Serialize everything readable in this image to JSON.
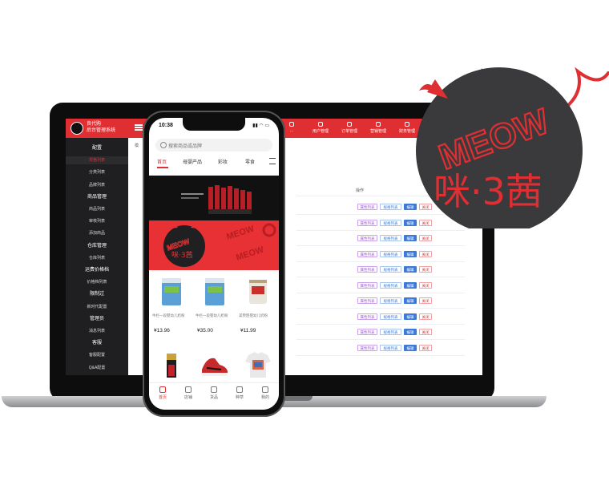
{
  "admin": {
    "brand": {
      "line1": "良代购",
      "line2": "后台管理系统"
    },
    "nav": [
      "…",
      "用户管理",
      "订单管理",
      "营销管理",
      "财务管理"
    ],
    "breadcrumb": "模",
    "sidebar": [
      {
        "label": "配置",
        "kind": "group"
      },
      {
        "label": "规格列表",
        "kind": "active"
      },
      {
        "label": "分类列表",
        "kind": "item"
      },
      {
        "label": "品牌列表",
        "kind": "item"
      },
      {
        "label": "商品管理",
        "kind": "group"
      },
      {
        "label": "商品列表",
        "kind": "item"
      },
      {
        "label": "审核列表",
        "kind": "item"
      },
      {
        "label": "添加商品",
        "kind": "item"
      },
      {
        "label": "仓库管理",
        "kind": "group"
      },
      {
        "label": "仓库列表",
        "kind": "item"
      },
      {
        "label": "运费价格档",
        "kind": "group"
      },
      {
        "label": "价格档列表",
        "kind": "item"
      },
      {
        "label": "限制过",
        "kind": "group"
      },
      {
        "label": "新时代配置",
        "kind": "item"
      },
      {
        "label": "管理员",
        "kind": "group"
      },
      {
        "label": "消息列表",
        "kind": "item"
      },
      {
        "label": "客服",
        "kind": "group"
      },
      {
        "label": "客服配置",
        "kind": "item"
      },
      {
        "label": "Q&A配置",
        "kind": "item"
      }
    ],
    "table": {
      "op_header": "操作",
      "buttons": {
        "attr": "属性列表",
        "spec": "规格列表",
        "edit": "编辑",
        "close": "关闭"
      },
      "row_count": 10
    }
  },
  "phone": {
    "time": "10:38",
    "status_icons": "▮▮ ◠ ▭",
    "search_placeholder": "搜索商品或品牌",
    "categories": [
      "首页",
      "母婴产品",
      "彩妆",
      "零食"
    ],
    "active_category": "首页",
    "products": [
      {
        "name": "牛栏一段婴幼儿奶粉",
        "price": "¥13.96"
      },
      {
        "name": "牛栏一段婴幼儿奶粉",
        "price": "¥35.00"
      },
      {
        "name": "美赞臣婴幼儿奶粉",
        "price": "¥11.99"
      }
    ],
    "banner_words": "MEOW",
    "bottom_nav": [
      "首页",
      "店铺",
      "货品",
      "种草",
      "我的"
    ]
  },
  "badge": {
    "word_en": "MEOW",
    "word_cn": "咪·3茜"
  },
  "colors": {
    "brand_red": "#e02f33",
    "sidebar_dark": "#1f1f21",
    "badge_dark": "#3a3a3c"
  }
}
